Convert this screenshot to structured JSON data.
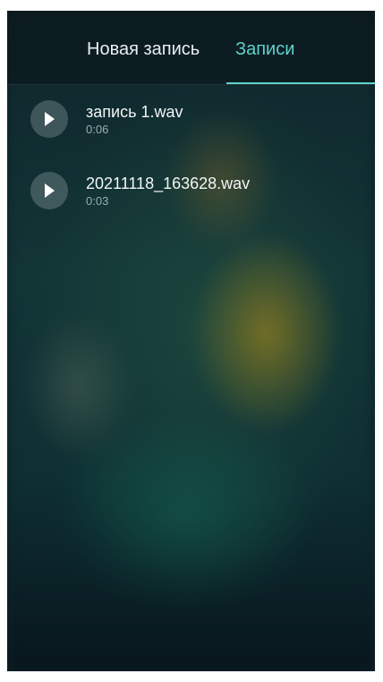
{
  "tabs": [
    {
      "label": "Новая запись",
      "active": false
    },
    {
      "label": "Записи",
      "active": true
    }
  ],
  "recordings": [
    {
      "name": "запись 1.wav",
      "duration": "0:06"
    },
    {
      "name": "20211118_163628.wav",
      "duration": "0:03"
    }
  ],
  "colors": {
    "accent": "#5ed3cd",
    "text_primary": "#f2f5f6",
    "text_secondary": "#9aaeb2",
    "play_button": "#96a5aa"
  },
  "icons": {
    "play": "play-icon"
  }
}
